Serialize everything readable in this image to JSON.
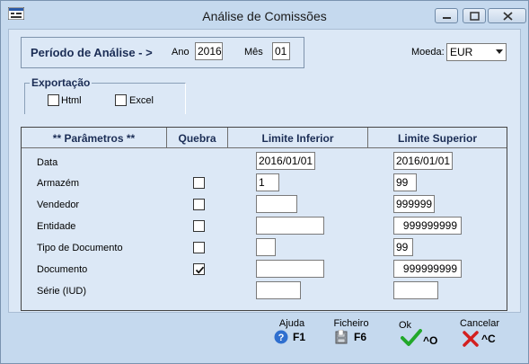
{
  "window": {
    "title": "Análise de Comissões"
  },
  "period": {
    "label": "Período de Análise - >",
    "year_label": "Ano",
    "year_value": "2016",
    "month_label": "Mês",
    "month_value": "01"
  },
  "currency": {
    "label": "Moeda:",
    "value": "EUR"
  },
  "export": {
    "title": "Exportação",
    "options": [
      {
        "label": "Html",
        "checked": false
      },
      {
        "label": "Excel",
        "checked": false
      }
    ]
  },
  "params": {
    "headers": [
      "**  Parâmetros  **",
      "Quebra",
      "Limite Inferior",
      "Limite Superior"
    ],
    "rows": [
      {
        "label": "Data",
        "quebra": null,
        "inf": "2016/01/01",
        "sup": "2016/01/01"
      },
      {
        "label": "Armazém",
        "quebra": false,
        "inf": "1",
        "sup": "99"
      },
      {
        "label": "Vendedor",
        "quebra": false,
        "inf": "",
        "sup": "999999"
      },
      {
        "label": "Entidade",
        "quebra": false,
        "inf": "",
        "sup": "999999999"
      },
      {
        "label": "Tipo de Documento",
        "quebra": false,
        "inf": "",
        "sup": "99"
      },
      {
        "label": "Documento",
        "quebra": true,
        "inf": "",
        "sup": "999999999"
      },
      {
        "label": "Série (IUD)",
        "quebra": null,
        "inf": "",
        "sup": ""
      }
    ]
  },
  "footer": {
    "help": {
      "label": "Ajuda",
      "key": "F1"
    },
    "file": {
      "label": "Ficheiro",
      "key": "F6"
    },
    "ok": {
      "label": "Ok",
      "key": "^O"
    },
    "cancel": {
      "label": "Cancelar",
      "key": "^C"
    }
  }
}
